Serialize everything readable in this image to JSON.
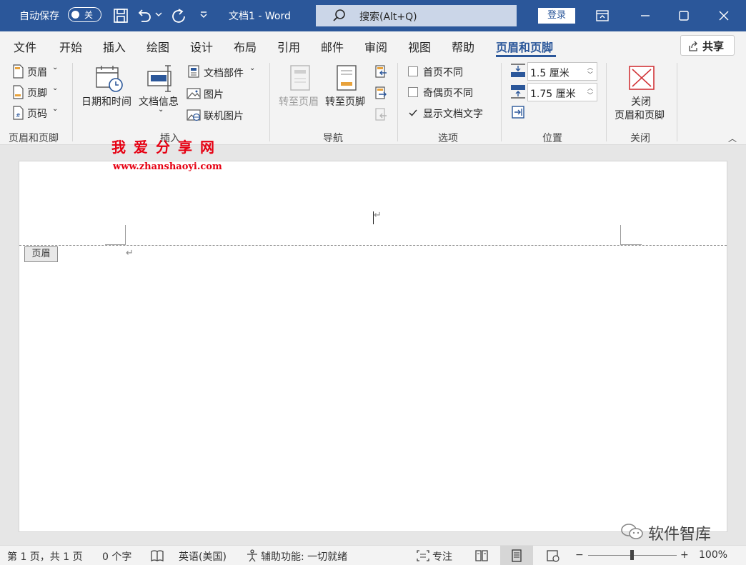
{
  "titlebar": {
    "autosave_label": "自动保存",
    "autosave_state": "关",
    "doc_title": "文档1  -  Word",
    "search_placeholder": "搜索(Alt+Q)",
    "login_label": "登录",
    "icons": [
      "save-icon",
      "undo-icon",
      "redo-icon",
      "customize-qat-icon",
      "ribbon-display-icon",
      "minimize-icon",
      "maximize-icon",
      "close-icon"
    ]
  },
  "menu": {
    "tabs": [
      "文件",
      "开始",
      "插入",
      "绘图",
      "设计",
      "布局",
      "引用",
      "邮件",
      "审阅",
      "视图",
      "帮助",
      "页眉和页脚"
    ],
    "active_tab": "页眉和页脚",
    "share_label": "共享"
  },
  "ribbon": {
    "hf_group": {
      "header": "页眉",
      "footer": "页脚",
      "page_number": "页码",
      "label": "页眉和页脚"
    },
    "insert_group": {
      "datetime": "日期和时间",
      "docinfo": "文档信息",
      "quickparts": "文档部件",
      "picture": "图片",
      "online_picture": "联机图片",
      "label": "插入"
    },
    "nav_group": {
      "goto_header": "转至页眉",
      "goto_footer": "转至页脚",
      "label": "导航"
    },
    "options_group": {
      "first_page": "首页不同",
      "odd_even": "奇偶页不同",
      "show_doc_text": "显示文档文字",
      "first_page_checked": false,
      "odd_even_checked": false,
      "show_doc_text_checked": true,
      "label": "选项"
    },
    "position_group": {
      "header_top": "1.5 厘米",
      "footer_bottom": "1.75 厘米",
      "label": "位置"
    },
    "close_group": {
      "close_line1": "关闭",
      "close_line2": "页眉和页脚",
      "label": "关闭"
    }
  },
  "document": {
    "header_tag": "页眉",
    "watermark_title": "我爱分享网",
    "watermark_url": "www.zhanshaoyi.com",
    "overlay_text": "软件智库"
  },
  "status": {
    "page": "第 1 页，共 1 页",
    "words": "0 个字",
    "language": "英语(美国)",
    "accessibility": "辅助功能: 一切就绪",
    "focus": "专注",
    "zoom": "100%",
    "minus": "−",
    "plus": "+"
  },
  "colors": {
    "brand": "#2b579a",
    "watermark": "#e60012",
    "close_icon": "#d13438"
  }
}
